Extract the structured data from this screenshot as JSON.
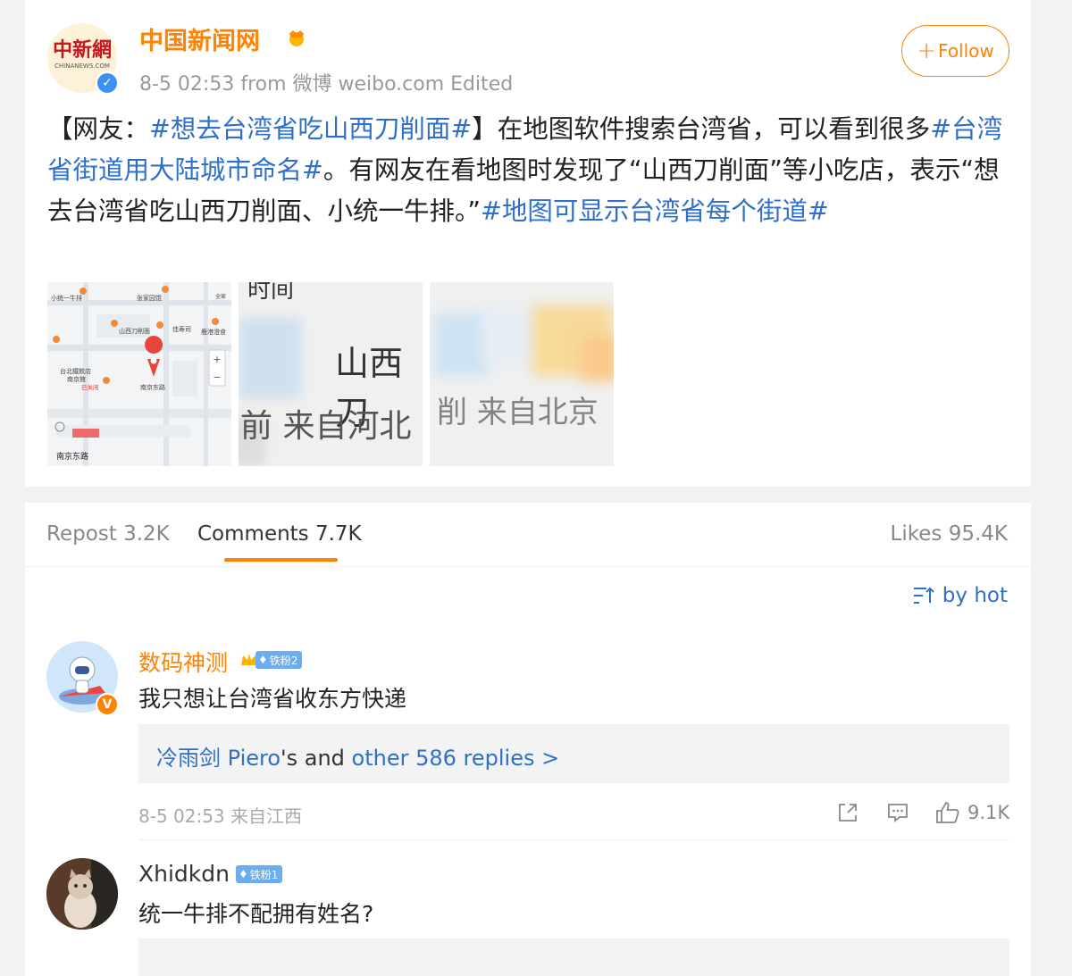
{
  "post": {
    "author": "中国新闻网",
    "avatar_text": "中新網",
    "avatar_subtext": "CHINANEWS.COM",
    "meta": "8-5 02:53  from 微博 weibo.com  Edited",
    "follow_label": "Follow",
    "text_parts": {
      "p1": "【网友：",
      "t1": "#想去台湾省吃山西刀削面#",
      "p2": "】在地图软件搜索台湾省，可以看到很多",
      "t2": "#台湾省街道用大陆城市命名#",
      "p3": "。有网友在看地图时发现了“山西刀削面”等小吃店，表示“想去台湾省吃山西刀削面、小统一牛排。”",
      "t3": "#地图可显示台湾省每个街道#"
    },
    "images": {
      "map_labels": [
        "小统一牛排",
        "张家园馄",
        "全家",
        "山西刀削面",
        "佳寿司",
        "鹿港澄食",
        "台北鐵飲店",
        "南京館",
        "已关闭",
        "南京东路",
        "南京东路"
      ],
      "img2_text_top": "时间",
      "img2_text_mid": "山西刀",
      "img2_text_bottom": "前 来自河北",
      "img3_text_bottom": "削 来自北京"
    }
  },
  "tabs": {
    "repost": "Repost 3.2K",
    "comments": "Comments 7.7K",
    "likes": "Likes 95.4K"
  },
  "sort_label": "by hot",
  "comments": [
    {
      "user": "数码神测",
      "badge": "铁粉2",
      "text": "我只想让台湾省收东方快递",
      "reply_user": "冷雨剑 Piero",
      "reply_mid": "'s and ",
      "reply_more": "other 586 replies >",
      "meta": "8-5 02:53 来自江西",
      "likes": "9.1K"
    },
    {
      "user": "Xhidkdn",
      "badge": "铁粉1",
      "text": "统一牛排不配拥有姓名?"
    }
  ],
  "colors": {
    "accent": "#ff8200",
    "link": "#2f6fc8"
  },
  "icons": [
    "verified-badge-icon",
    "plus-icon",
    "sort-icon",
    "share-icon",
    "comment-icon",
    "like-icon",
    "map-pin-icon"
  ]
}
